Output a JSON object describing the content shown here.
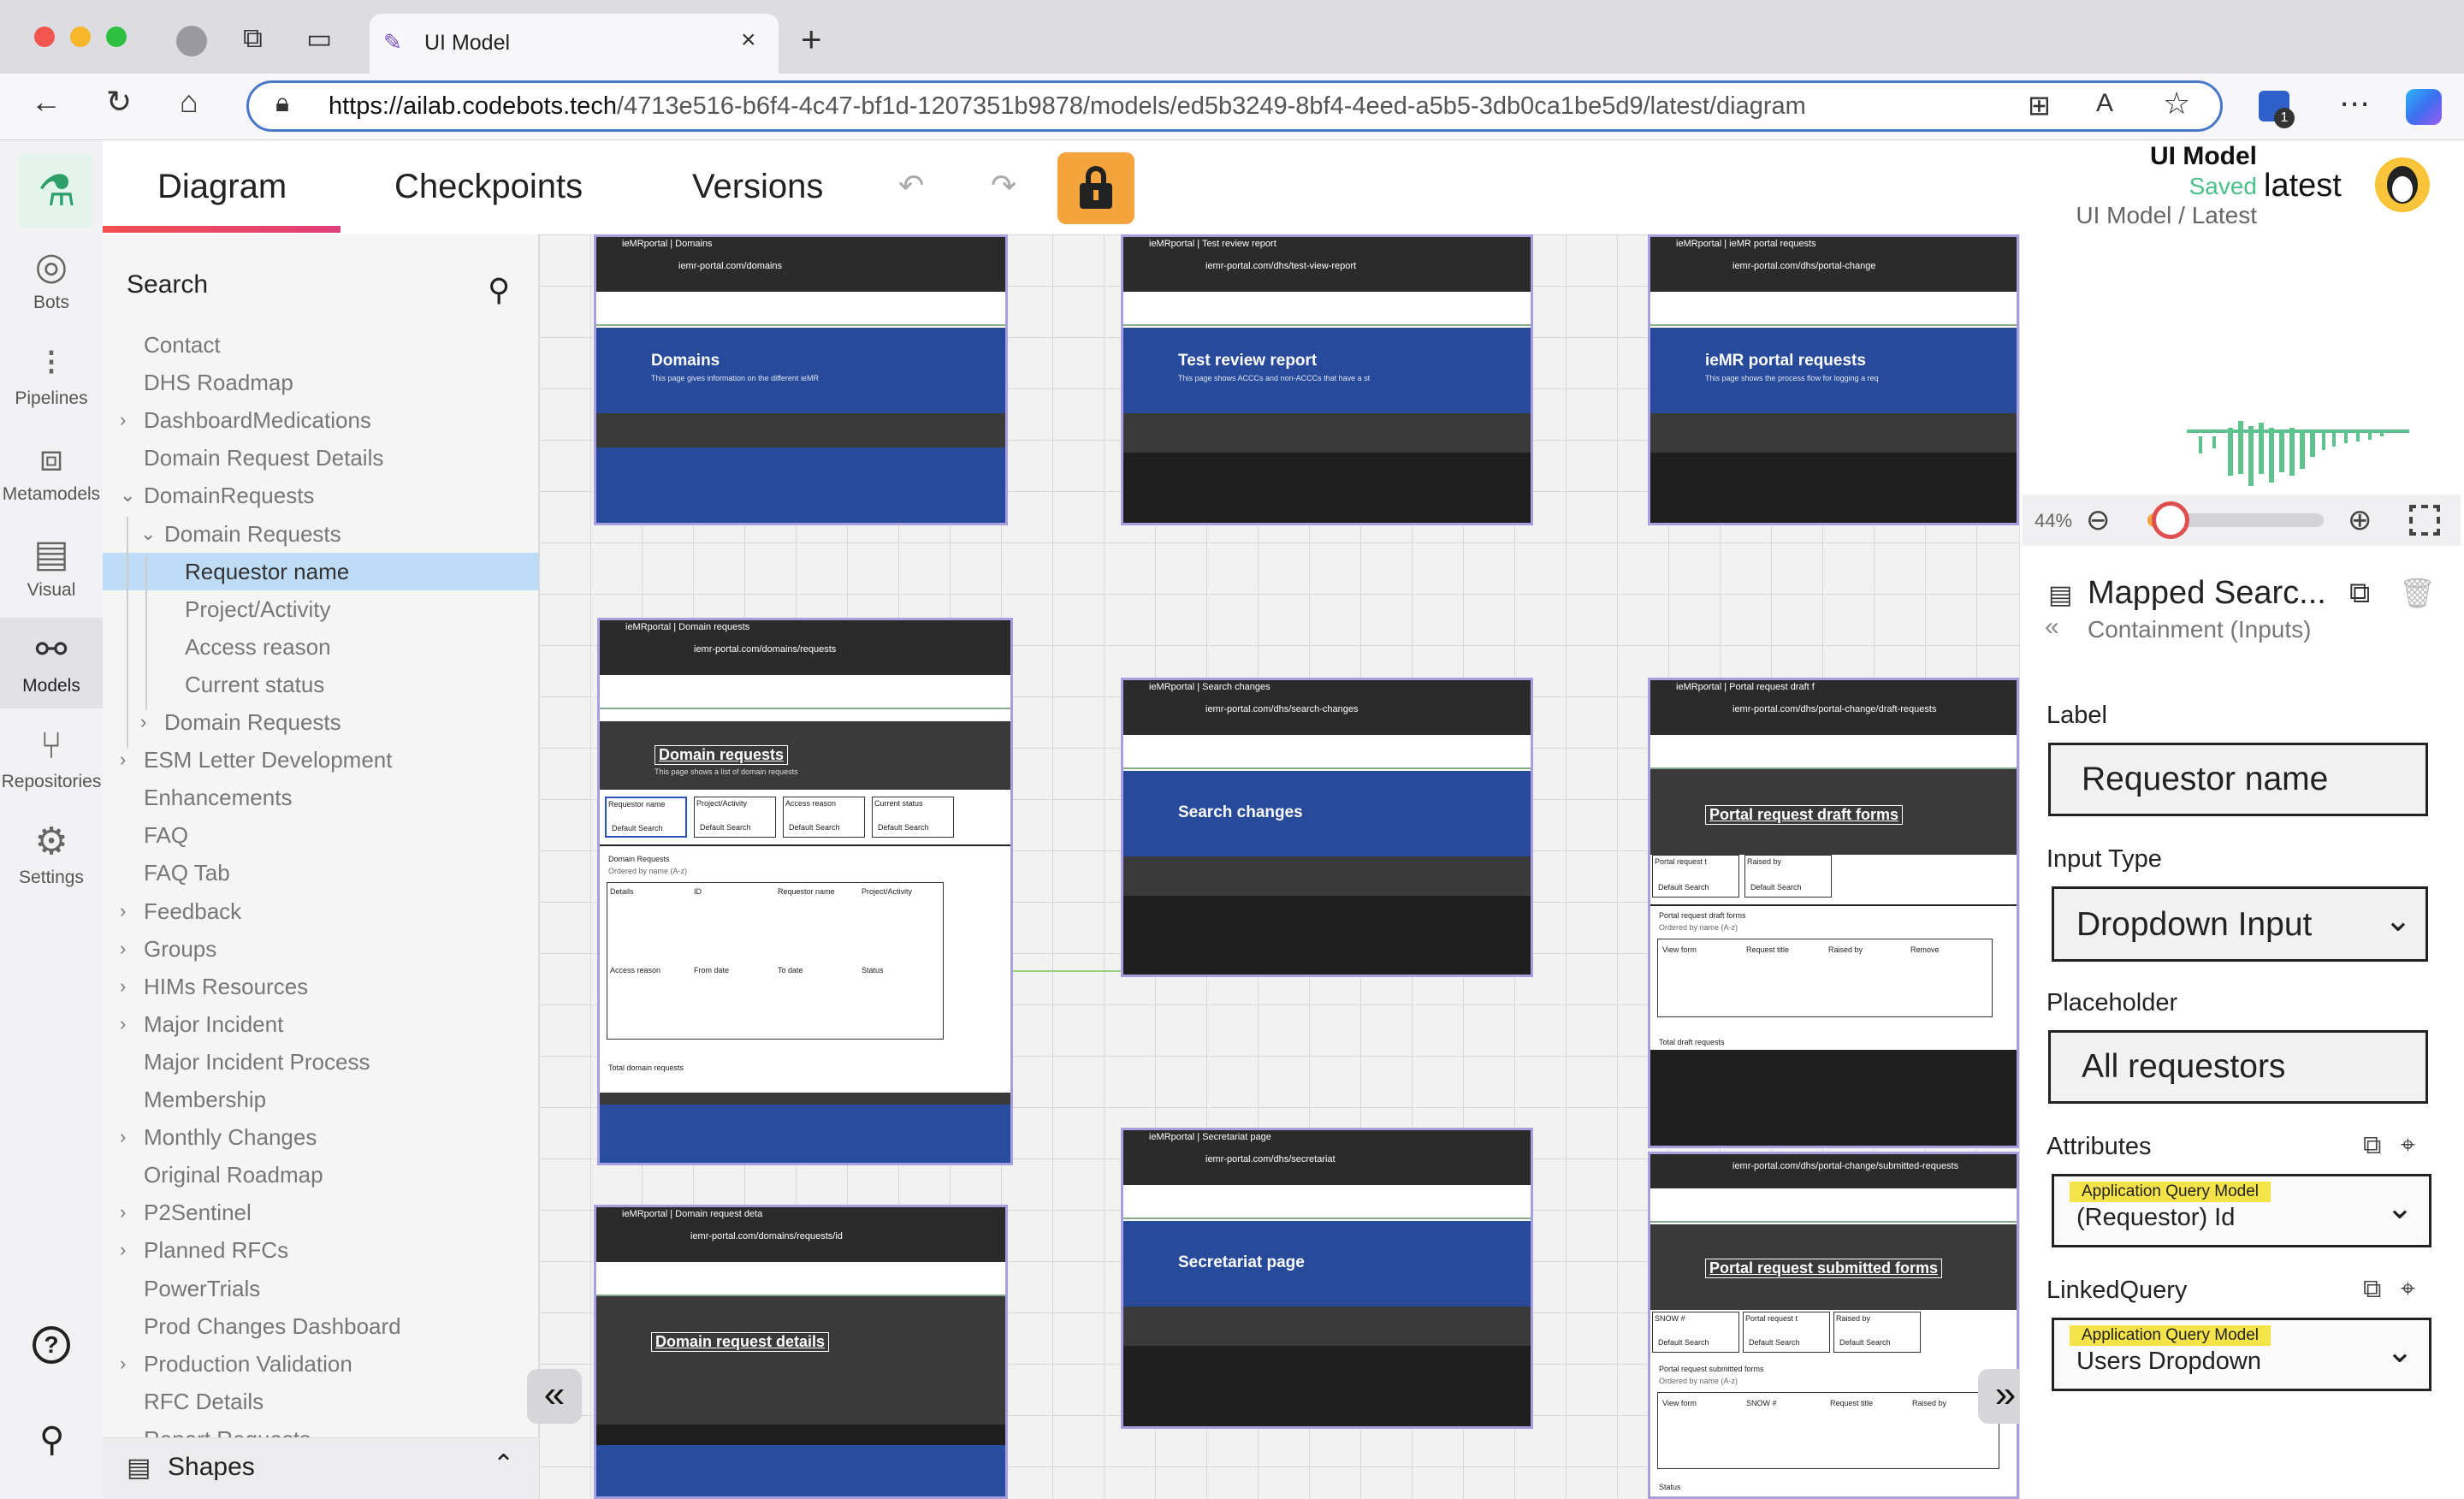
{
  "browser": {
    "tab_title": "UI Model",
    "url_host": "https://ailab.codebots.tech",
    "url_path": "/4713e516-b6f4-4c47-bf1d-1207351b9878/models/ed5b3249-8bf4-4eed-a5b5-3db0ca1be5d9/latest/diagram",
    "badge_count": "1"
  },
  "rail": {
    "items": [
      {
        "label": "Bots",
        "icon": "bot-icon"
      },
      {
        "label": "Pipelines",
        "icon": "pipeline-icon"
      },
      {
        "label": "Metamodels",
        "icon": "metamodel-icon"
      },
      {
        "label": "Visual",
        "icon": "visual-icon"
      },
      {
        "label": "Models",
        "icon": "models-icon"
      },
      {
        "label": "Repositories",
        "icon": "repository-icon"
      },
      {
        "label": "Settings",
        "icon": "settings-icon"
      }
    ]
  },
  "header": {
    "tabs": [
      "Diagram",
      "Checkpoints",
      "Versions"
    ],
    "model_name": "UI Model",
    "status": "Saved",
    "breadcrumb": "UI Model / Latest",
    "version": "latest"
  },
  "sidebar": {
    "search_label": "Search",
    "tree": [
      {
        "label": "Contact",
        "indent": 0,
        "chevron": ""
      },
      {
        "label": "DHS Roadmap",
        "indent": 0,
        "chevron": ""
      },
      {
        "label": "DashboardMedications",
        "indent": 0,
        "chevron": "›"
      },
      {
        "label": "Domain Request Details",
        "indent": 0,
        "chevron": ""
      },
      {
        "label": "DomainRequests",
        "indent": 0,
        "chevron": "⌄"
      },
      {
        "label": "Domain Requests",
        "indent": 1,
        "chevron": "⌄"
      },
      {
        "label": "Requestor name",
        "indent": 2,
        "chevron": ""
      },
      {
        "label": "Project/Activity",
        "indent": 2,
        "chevron": ""
      },
      {
        "label": "Access reason",
        "indent": 2,
        "chevron": ""
      },
      {
        "label": "Current status",
        "indent": 2,
        "chevron": ""
      },
      {
        "label": "Domain Requests",
        "indent": 1,
        "chevron": "›"
      },
      {
        "label": "ESM Letter Development",
        "indent": 0,
        "chevron": "›"
      },
      {
        "label": "Enhancements",
        "indent": 0,
        "chevron": ""
      },
      {
        "label": "FAQ",
        "indent": 0,
        "chevron": ""
      },
      {
        "label": "FAQ Tab",
        "indent": 0,
        "chevron": ""
      },
      {
        "label": "Feedback",
        "indent": 0,
        "chevron": "›"
      },
      {
        "label": "Groups",
        "indent": 0,
        "chevron": "›"
      },
      {
        "label": "HIMs Resources",
        "indent": 0,
        "chevron": "›"
      },
      {
        "label": "Major Incident",
        "indent": 0,
        "chevron": "›"
      },
      {
        "label": "Major Incident Process",
        "indent": 0,
        "chevron": ""
      },
      {
        "label": "Membership",
        "indent": 0,
        "chevron": ""
      },
      {
        "label": "Monthly Changes",
        "indent": 0,
        "chevron": "›"
      },
      {
        "label": "Original Roadmap",
        "indent": 0,
        "chevron": ""
      },
      {
        "label": "P2Sentinel",
        "indent": 0,
        "chevron": "›"
      },
      {
        "label": "Planned RFCs",
        "indent": 0,
        "chevron": "›"
      },
      {
        "label": "PowerTrials",
        "indent": 0,
        "chevron": ""
      },
      {
        "label": "Prod Changes Dashboard",
        "indent": 0,
        "chevron": ""
      },
      {
        "label": "Production Validation",
        "indent": 0,
        "chevron": "›"
      },
      {
        "label": "RFC Details",
        "indent": 0,
        "chevron": ""
      },
      {
        "label": "Report Requests",
        "indent": 0,
        "chevron": ""
      }
    ],
    "selected": "Requestor name",
    "shapes_label": "Shapes"
  },
  "canvas": {
    "screens": [
      {
        "tab": "ieMRportal | Domains",
        "url": "iemr-portal.com/domains",
        "title": "Domains",
        "sub": "This page gives information on the different ieMR"
      },
      {
        "tab": "ieMRportal | Test review report",
        "url": "iemr-portal.com/dhs/test-view-report",
        "title": "Test review report",
        "sub": "This page shows ACCCs and non-ACCCs that have a st"
      },
      {
        "tab": "ieMRportal | ieMR portal requests",
        "url": "iemr-portal.com/dhs/portal-change",
        "title": "ieMR portal requests",
        "sub": "This page shows the process flow for logging a req"
      },
      {
        "tab": "ieMRportal | Domain requests",
        "url": "iemr-portal.com/domains/requests",
        "title": "Domain requests",
        "sub": "This page shows a list of domain requests",
        "filters": [
          "Requestor name",
          "Project/Activity",
          "Access reason",
          "Current status"
        ],
        "filter_placeholder": "Default Search",
        "list_title": "Domain Requests",
        "list_sub": "Ordered by name (A-z)",
        "columns1": [
          "Details",
          "ID",
          "Requestor name",
          "Project/Activity"
        ],
        "columns2": [
          "Access reason",
          "From date",
          "To date",
          "Status"
        ],
        "total": "Total domain requests"
      },
      {
        "tab": "ieMRportal | Search changes",
        "url": "iemr-portal.com/dhs/search-changes",
        "title": "Search changes"
      },
      {
        "tab": "ieMRportal | Portal request draft f",
        "url": "iemr-portal.com/dhs/portal-change/draft-requests",
        "title": "Portal request draft forms",
        "filters": [
          "Portal request t",
          "Raised by"
        ],
        "filter_placeholder": "Default Search",
        "list_title": "Portal request draft forms",
        "list_sub": "Ordered by name (A-z)",
        "columns": [
          "View form",
          "Request title",
          "Raised by",
          "Remove"
        ],
        "total": "Total draft requests"
      },
      {
        "tab": "ieMRportal | Domain request deta",
        "url": "iemr-portal.com/domains/requests/id",
        "title": "Domain request details"
      },
      {
        "tab": "ieMRportal | Secretariat page",
        "url": "iemr-portal.com/dhs/secretariat",
        "title": "Secretariat page"
      },
      {
        "tab": "",
        "url": "iemr-portal.com/dhs/portal-change/submitted-requests",
        "title": "Portal request submitted forms",
        "filters": [
          "SNOW #",
          "Portal request t",
          "Raised by"
        ],
        "filter_placeholder": "Default Search",
        "list_title": "Portal request submitted forms",
        "list_sub": "Ordered by name (A-z)",
        "columns": [
          "View form",
          "SNOW #",
          "Request title",
          "Raised by"
        ],
        "extra": "Status"
      }
    ]
  },
  "right_panel": {
    "zoom": "44%",
    "zoom_level": 0.13,
    "title": "Mapped Searc...",
    "subtitle": "Containment (Inputs)",
    "label_label": "Label",
    "label_value": "Requestor name",
    "input_type_label": "Input Type",
    "input_type_value": "Dropdown Input",
    "placeholder_label": "Placeholder",
    "placeholder_value": "All requestors",
    "attributes_label": "Attributes",
    "attributes_tag": "Application Query Model",
    "attributes_value": "(Requestor) Id",
    "linked_label": "LinkedQuery",
    "linked_tag": "Application Query Model",
    "linked_value": "Users Dropdown"
  },
  "colors": {
    "accent": "#f4a43c",
    "saved": "#4cc08a",
    "selected": "#bfdcf7",
    "hero_blue": "#274a9b",
    "screen_border": "#a89fe0"
  }
}
